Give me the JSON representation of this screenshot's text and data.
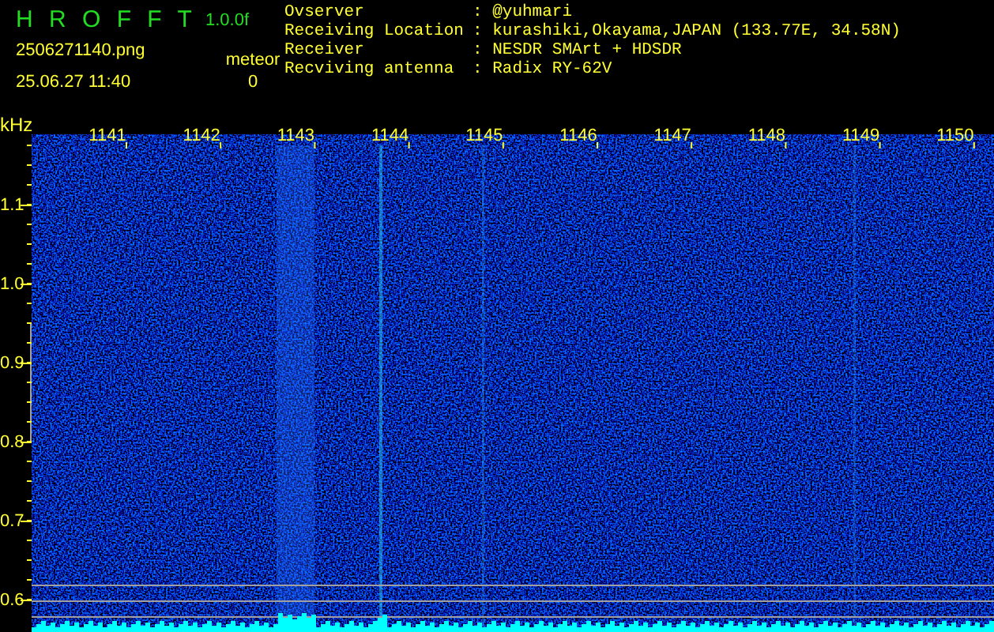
{
  "app": {
    "title": "H R O F F T",
    "version": "1.0.0f"
  },
  "file": {
    "filename": "2506271140.png",
    "timestamp": "25.06.27 11:40"
  },
  "counter": {
    "label": "meteor",
    "value": "0"
  },
  "info": [
    {
      "label": "Ovserver",
      "value": ": @yuhmari"
    },
    {
      "label": "Receiving Location",
      "value": ": kurashiki,Okayama,JAPAN (133.77E, 34.58N)"
    },
    {
      "label": "Receiver",
      "value": ": NESDR SMArt + HDSDR"
    },
    {
      "label": "Recviving antenna",
      "value": ": Radix RY-62V"
    }
  ],
  "spectrogram": {
    "y_unit": "kHz",
    "x_ticks": [
      "1141",
      "1142",
      "1143",
      "1144",
      "1145",
      "1146",
      "1147",
      "1148",
      "1149",
      "1150"
    ],
    "y_ticks": [
      "1.1",
      "1.0",
      "0.9",
      "0.8",
      "0.7",
      "0.6"
    ]
  }
}
